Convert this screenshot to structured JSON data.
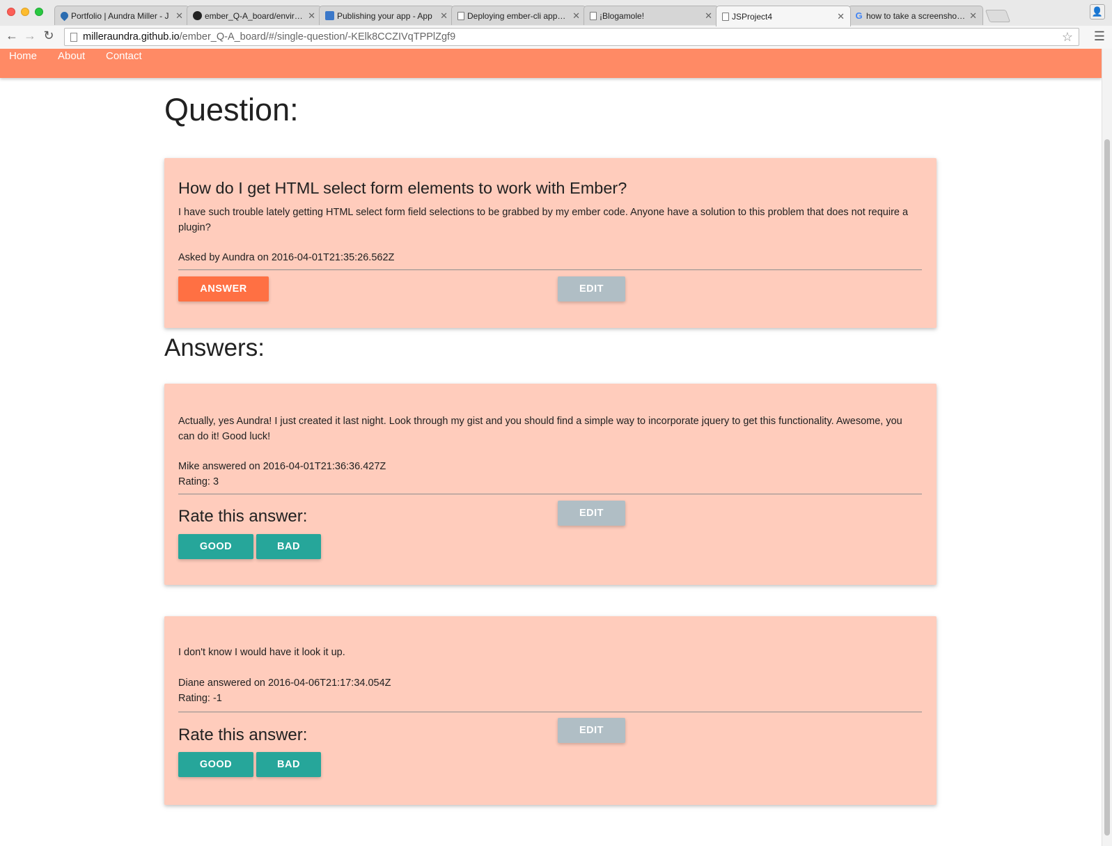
{
  "browser": {
    "tabs": [
      {
        "label": "Portfolio | Aundra Miller - J",
        "icon": "drop-favicon-icon",
        "active": false
      },
      {
        "label": "ember_Q-A_board/environn",
        "icon": "github-favicon-icon",
        "active": false
      },
      {
        "label": "Publishing your app - App",
        "icon": "publish-favicon-icon",
        "active": false
      },
      {
        "label": "Deploying ember-cli apps a",
        "icon": "document-favicon-icon",
        "active": false
      },
      {
        "label": "¡Blogamole!",
        "icon": "document-favicon-icon",
        "active": false
      },
      {
        "label": "JSProject4",
        "icon": "document-favicon-icon",
        "active": true
      },
      {
        "label": "how to take a screenshot o",
        "icon": "google-favicon-icon",
        "active": false
      }
    ],
    "url_host": "milleraundra.github.io",
    "url_path": "/ember_Q-A_board/#/single-question/-KElk8CCZIVqTPPlZgf9"
  },
  "nav": {
    "home": "Home",
    "about": "About",
    "contact": "Contact"
  },
  "page_title": "Question:",
  "question": {
    "title": "How do I get HTML select form elements to work with Ember?",
    "body": "I have such trouble lately getting HTML select form field selections to be grabbed by my ember code. Anyone have a solution to this problem that does not require a plugin?",
    "asked_by": "Asked by Aundra on 2016-04-01T21:35:26.562Z",
    "answer_button": "ANSWER",
    "edit_button": "EDIT"
  },
  "answers_title": "Answers:",
  "answers": [
    {
      "body": "Actually, yes Aundra! I just created it last night. Look through my gist and you should find a simple way to incorporate jquery to get this functionality. Awesome, you can do it! Good luck!",
      "answered_by": "Mike answered on 2016-04-01T21:36:36.427Z",
      "rating": "Rating: 3",
      "rate_label": "Rate this answer:",
      "good_button": "GOOD",
      "bad_button": "BAD",
      "edit_button": "EDIT"
    },
    {
      "body": "I don't know I would have it look it up.",
      "answered_by": "Diane answered on 2016-04-06T21:17:34.054Z",
      "rating": "Rating: -1",
      "rate_label": "Rate this answer:",
      "good_button": "GOOD",
      "bad_button": "BAD",
      "edit_button": "EDIT"
    }
  ],
  "colors": {
    "navbar": "#ff8a65",
    "card": "#ffccbc",
    "answer_button": "#ff7043",
    "edit_button": "#b0bec5",
    "rate_buttons": "#26a69a"
  }
}
